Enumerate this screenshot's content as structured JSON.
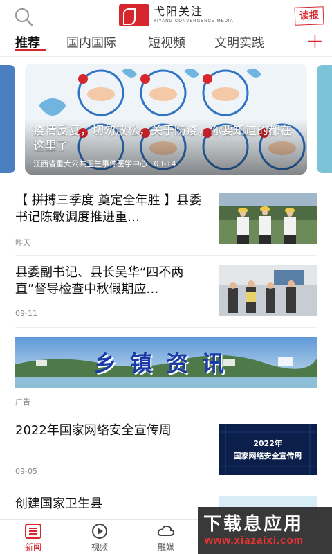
{
  "header": {
    "logo_title": "弋阳关注",
    "logo_subtitle": "YIYANG CONVERGENCE MEDIA",
    "read_label": "读报",
    "search_icon": "search-icon"
  },
  "tabs": [
    {
      "label": "推荐",
      "active": true
    },
    {
      "label": "国内国际",
      "active": false
    },
    {
      "label": "短视频",
      "active": false
    },
    {
      "label": "文明实践",
      "active": false
    }
  ],
  "carousel": {
    "title": "疫情反复，切勿放松，关于防疫，你要知道的都在这里了",
    "source": "江西省重大公共卫生事件医学中心",
    "date": "03-14"
  },
  "news": [
    {
      "title": "【 拼搏三季度 奠定全年胜 】县委书记陈敏调度推进重…",
      "time": "昨天"
    },
    {
      "title": "县委副书记、县长吴华“四不两直”督导检查中秋假期应…",
      "time": "09-11"
    },
    {
      "title": "2022年国家网络安全宣传周",
      "time": "09-05",
      "thumb_line1": "2022年",
      "thumb_line2": "国家网络安全宣传周"
    },
    {
      "title": "创建国家卫生县"
    }
  ],
  "ad": {
    "banner_text": "乡镇资讯",
    "label": "广告"
  },
  "bottom_nav": [
    {
      "label": "新闻",
      "icon": "news-icon",
      "active": true
    },
    {
      "label": "视频",
      "icon": "play-icon",
      "active": false
    },
    {
      "label": "融媒",
      "icon": "cloud-icon",
      "active": false
    }
  ],
  "watermark": {
    "main": "下载息应用",
    "sub": "www.xiazaixi.com"
  },
  "colors": {
    "accent": "#d8262e",
    "text": "#111111",
    "muted": "#888888"
  }
}
